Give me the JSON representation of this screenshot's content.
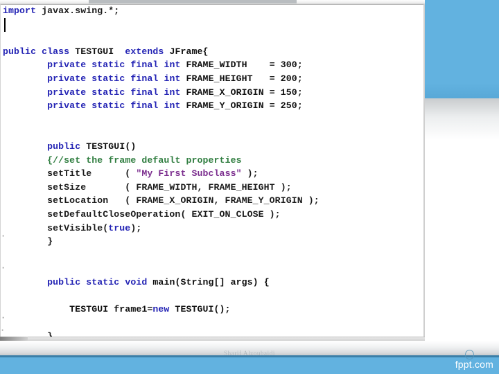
{
  "slide": {
    "background_color": "#ffffff",
    "accent_color": "#62b2e0",
    "accent_dark_color": "#3b7fa8"
  },
  "screenshot": {
    "name": "java-source-code-screenshot",
    "editor_background": "#ffffff",
    "colors": {
      "keyword": "#2323b4",
      "comment": "#2f7d3f",
      "string": "#7b2d8e",
      "identifier": "#101010",
      "number": "#101010"
    },
    "code_lines": [
      {
        "indent": 1,
        "tokens": [
          {
            "t": "import",
            "c": "kw"
          },
          {
            "t": " javax.swing.*;",
            "c": "plain"
          }
        ]
      },
      {
        "indent": 0,
        "tokens": [
          {
            "t": "",
            "c": "plain"
          }
        ]
      },
      {
        "indent": 0,
        "tokens": [
          {
            "t": "",
            "c": "plain"
          }
        ]
      },
      {
        "indent": 0,
        "tokens": [
          {
            "t": "public",
            "c": "kw"
          },
          {
            "t": " ",
            "c": "plain"
          },
          {
            "t": "class",
            "c": "kw"
          },
          {
            "t": " ",
            "c": "plain"
          },
          {
            "t": "TESTGUI",
            "c": "id"
          },
          {
            "t": "  ",
            "c": "plain"
          },
          {
            "t": "extends",
            "c": "kw"
          },
          {
            "t": " ",
            "c": "plain"
          },
          {
            "t": "JFrame{",
            "c": "id"
          }
        ]
      },
      {
        "indent": 0,
        "tokens": [
          {
            "t": "        ",
            "c": "plain"
          },
          {
            "t": "private",
            "c": "kw"
          },
          {
            "t": " ",
            "c": "plain"
          },
          {
            "t": "static",
            "c": "kw"
          },
          {
            "t": " ",
            "c": "plain"
          },
          {
            "t": "final",
            "c": "kw"
          },
          {
            "t": " ",
            "c": "plain"
          },
          {
            "t": "int",
            "c": "kw"
          },
          {
            "t": " ",
            "c": "plain"
          },
          {
            "t": "FRAME_WIDTH",
            "c": "id"
          },
          {
            "t": "    = ",
            "c": "plain"
          },
          {
            "t": "300",
            "c": "num"
          },
          {
            "t": ";",
            "c": "plain"
          }
        ]
      },
      {
        "indent": 0,
        "tokens": [
          {
            "t": "        ",
            "c": "plain"
          },
          {
            "t": "private",
            "c": "kw"
          },
          {
            "t": " ",
            "c": "plain"
          },
          {
            "t": "static",
            "c": "kw"
          },
          {
            "t": " ",
            "c": "plain"
          },
          {
            "t": "final",
            "c": "kw"
          },
          {
            "t": " ",
            "c": "plain"
          },
          {
            "t": "int",
            "c": "kw"
          },
          {
            "t": " ",
            "c": "plain"
          },
          {
            "t": "FRAME_HEIGHT",
            "c": "id"
          },
          {
            "t": "   = ",
            "c": "plain"
          },
          {
            "t": "200",
            "c": "num"
          },
          {
            "t": ";",
            "c": "plain"
          }
        ]
      },
      {
        "indent": 0,
        "tokens": [
          {
            "t": "        ",
            "c": "plain"
          },
          {
            "t": "private",
            "c": "kw"
          },
          {
            "t": " ",
            "c": "plain"
          },
          {
            "t": "static",
            "c": "kw"
          },
          {
            "t": " ",
            "c": "plain"
          },
          {
            "t": "final",
            "c": "kw"
          },
          {
            "t": " ",
            "c": "plain"
          },
          {
            "t": "int",
            "c": "kw"
          },
          {
            "t": " ",
            "c": "plain"
          },
          {
            "t": "FRAME_X_ORIGIN",
            "c": "id"
          },
          {
            "t": " = ",
            "c": "plain"
          },
          {
            "t": "150",
            "c": "num"
          },
          {
            "t": ";",
            "c": "plain"
          }
        ]
      },
      {
        "indent": 0,
        "tokens": [
          {
            "t": "        ",
            "c": "plain"
          },
          {
            "t": "private",
            "c": "kw"
          },
          {
            "t": " ",
            "c": "plain"
          },
          {
            "t": "static",
            "c": "kw"
          },
          {
            "t": " ",
            "c": "plain"
          },
          {
            "t": "final",
            "c": "kw"
          },
          {
            "t": " ",
            "c": "plain"
          },
          {
            "t": "int",
            "c": "kw"
          },
          {
            "t": " ",
            "c": "plain"
          },
          {
            "t": "FRAME_Y_ORIGIN",
            "c": "id"
          },
          {
            "t": " = ",
            "c": "plain"
          },
          {
            "t": "250",
            "c": "num"
          },
          {
            "t": ";",
            "c": "plain"
          }
        ]
      },
      {
        "indent": 0,
        "tokens": [
          {
            "t": "",
            "c": "plain"
          }
        ]
      },
      {
        "indent": 0,
        "tokens": [
          {
            "t": "",
            "c": "plain"
          }
        ]
      },
      {
        "indent": 0,
        "tokens": [
          {
            "t": "        ",
            "c": "plain"
          },
          {
            "t": "public",
            "c": "kw"
          },
          {
            "t": " ",
            "c": "plain"
          },
          {
            "t": "TESTGUI()",
            "c": "id"
          }
        ]
      },
      {
        "indent": 0,
        "tokens": [
          {
            "t": "        ",
            "c": "plain"
          },
          {
            "t": "{//set the frame default properties",
            "c": "cmt"
          }
        ]
      },
      {
        "indent": 0,
        "tokens": [
          {
            "t": "        setTitle      ( ",
            "c": "plain"
          },
          {
            "t": "\"My First Subclass\"",
            "c": "str"
          },
          {
            "t": " );",
            "c": "plain"
          }
        ]
      },
      {
        "indent": 0,
        "tokens": [
          {
            "t": "        setSize       ( FRAME_WIDTH, FRAME_HEIGHT );",
            "c": "plain"
          }
        ]
      },
      {
        "indent": 0,
        "tokens": [
          {
            "t": "        setLocation   ( FRAME_X_ORIGIN, FRAME_Y_ORIGIN );",
            "c": "plain"
          }
        ]
      },
      {
        "indent": 0,
        "tokens": [
          {
            "t": "        setDefaultCloseOperation( EXIT_ON_CLOSE );",
            "c": "plain"
          }
        ]
      },
      {
        "indent": 0,
        "tokens": [
          {
            "t": "        setVisible(",
            "c": "plain"
          },
          {
            "t": "true",
            "c": "kw"
          },
          {
            "t": ");",
            "c": "plain"
          }
        ]
      },
      {
        "indent": 0,
        "tokens": [
          {
            "t": "        }",
            "c": "plain"
          }
        ]
      },
      {
        "indent": 0,
        "tokens": [
          {
            "t": "",
            "c": "plain"
          }
        ]
      },
      {
        "indent": 0,
        "tokens": [
          {
            "t": "",
            "c": "plain"
          }
        ]
      },
      {
        "indent": 0,
        "tokens": [
          {
            "t": "        ",
            "c": "plain"
          },
          {
            "t": "public",
            "c": "kw"
          },
          {
            "t": " ",
            "c": "plain"
          },
          {
            "t": "static",
            "c": "kw"
          },
          {
            "t": " ",
            "c": "plain"
          },
          {
            "t": "void",
            "c": "kw"
          },
          {
            "t": " ",
            "c": "plain"
          },
          {
            "t": "main(String[] args) {",
            "c": "id"
          }
        ]
      },
      {
        "indent": 0,
        "tokens": [
          {
            "t": "",
            "c": "plain"
          }
        ]
      },
      {
        "indent": 0,
        "tokens": [
          {
            "t": "            TESTGUI frame1=",
            "c": "id"
          },
          {
            "t": "new",
            "c": "kw"
          },
          {
            "t": " TESTGUI();",
            "c": "id"
          }
        ]
      },
      {
        "indent": 0,
        "tokens": [
          {
            "t": "",
            "c": "plain"
          }
        ]
      },
      {
        "indent": 0,
        "tokens": [
          {
            "t": "        }",
            "c": "plain"
          }
        ]
      },
      {
        "indent": 0,
        "tokens": [
          {
            "t": "}",
            "c": "plain"
          }
        ]
      }
    ]
  },
  "footer": {
    "author_watermark": "Sharif Alzoubaidi",
    "logo_text": "fppt.com"
  }
}
